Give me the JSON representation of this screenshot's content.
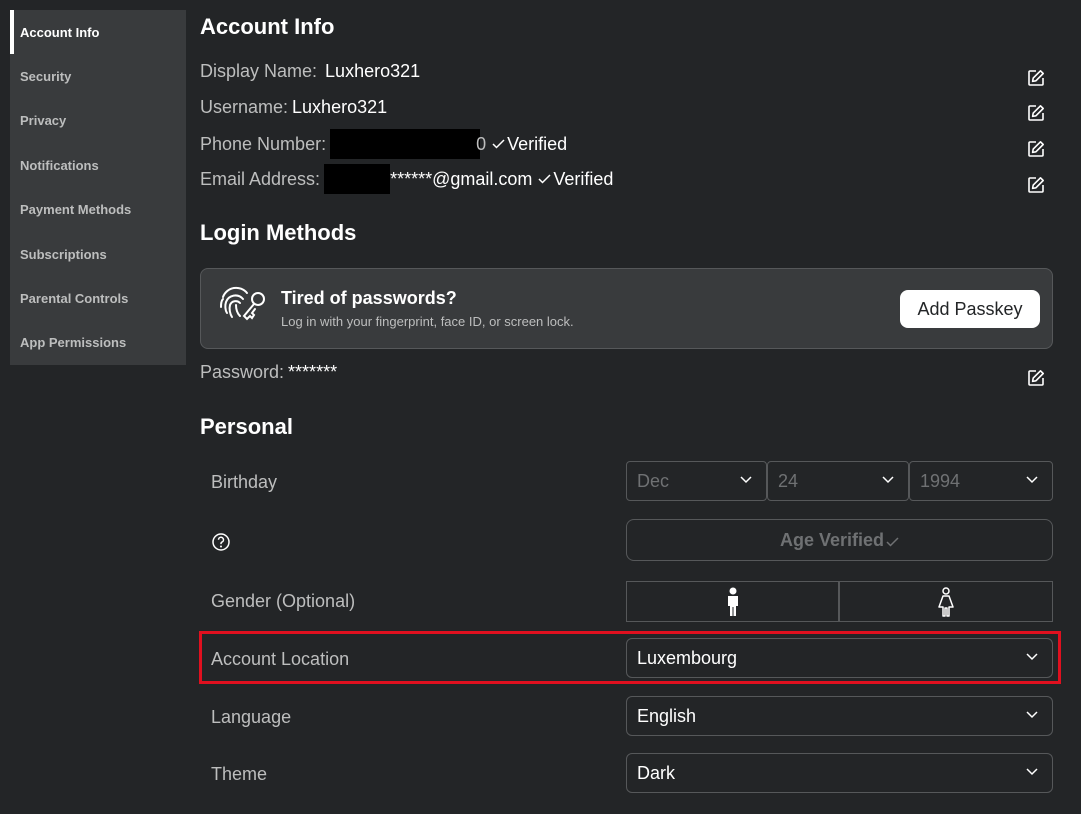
{
  "sidebar": {
    "items": [
      {
        "label": "Account Info",
        "active": true
      },
      {
        "label": "Security"
      },
      {
        "label": "Privacy"
      },
      {
        "label": "Notifications"
      },
      {
        "label": "Payment Methods"
      },
      {
        "label": "Subscriptions"
      },
      {
        "label": "Parental Controls"
      },
      {
        "label": "App Permissions"
      }
    ]
  },
  "account_info": {
    "title": "Account Info",
    "display_name_label": "Display Name:",
    "display_name": "Luxhero321",
    "username_label": "Username:",
    "username": "Luxhero321",
    "phone_label": "Phone Number:",
    "phone_visible_tail": "0",
    "phone_status": "Verified",
    "email_label": "Email Address:",
    "email_visible": "******@gmail.com",
    "email_status": "Verified"
  },
  "login_methods": {
    "title": "Login Methods",
    "passkey_title": "Tired of passwords?",
    "passkey_subtitle": "Log in with your fingerprint, face ID, or screen lock.",
    "passkey_button": "Add Passkey",
    "password_label": "Password:",
    "password_value": "*******"
  },
  "personal": {
    "title": "Personal",
    "birthday_label": "Birthday",
    "birthday_month": "Dec",
    "birthday_day": "24",
    "birthday_year": "1994",
    "age_verified": "Age Verified",
    "gender_label": "Gender (Optional)",
    "location_label": "Account Location",
    "location_value": "Luxembourg",
    "language_label": "Language",
    "language_value": "English",
    "theme_label": "Theme",
    "theme_value": "Dark"
  },
  "colors": {
    "background": "#232527",
    "sidebar": "#393b3d",
    "border": "#56585a",
    "highlight": "#e0101f"
  },
  "icons": {
    "edit": "edit-icon",
    "check": "checkmark-icon",
    "fingerprint": "fingerprint-key-icon",
    "chevron": "chevron-down-icon",
    "help": "help-circle-icon",
    "male": "male-icon",
    "female": "female-icon"
  }
}
